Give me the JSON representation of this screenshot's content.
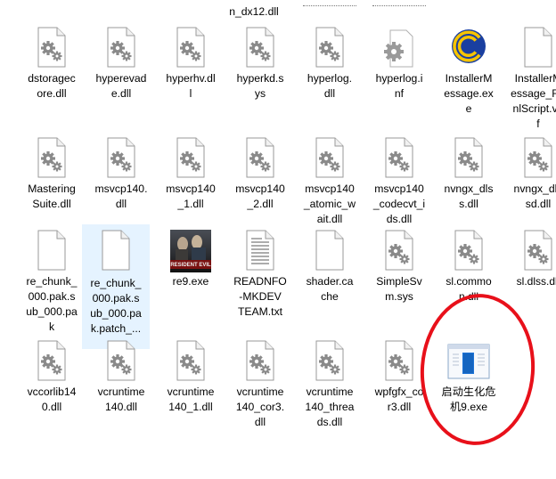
{
  "top_fragments": [
    "n_dx12.dll",
    "",
    ""
  ],
  "rows": [
    [
      {
        "name": "dstoragecore.dll",
        "label": "dstoragec\nore.dll",
        "icon": "dll-gear-icon"
      },
      {
        "name": "hyperevade.dll",
        "label": "hyperevad\ne.dll",
        "icon": "dll-gear-icon"
      },
      {
        "name": "hyperhv.dll",
        "label": "hyperhv.dl\nl",
        "icon": "dll-gear-icon"
      },
      {
        "name": "hyperkd.sys",
        "label": "hyperkd.s\nys",
        "icon": "dll-gear-icon"
      },
      {
        "name": "hyperlog.dll",
        "label": "hyperlog.\ndll",
        "icon": "dll-gear-icon"
      },
      {
        "name": "hyperlog.inf",
        "label": "hyperlog.i\nnf",
        "icon": "inf-gear-icon"
      },
      {
        "name": "InstallerMessage.exe",
        "label": "InstallerM\nessage.ex\ne",
        "icon": "capcom-logo-icon"
      },
      {
        "name": "InstallerMessage_RunScript.vdf",
        "label": "InstallerM\nessage_Ru\nnlScript.vd\nf",
        "icon": "blank-file-icon"
      }
    ],
    [
      {
        "name": "MasteringSuite.dll",
        "label": "Mastering\nSuite.dll",
        "icon": "dll-gear-icon"
      },
      {
        "name": "msvcp140.dll",
        "label": "msvcp140.\ndll",
        "icon": "dll-gear-icon"
      },
      {
        "name": "msvcp140_1.dll",
        "label": "msvcp140\n_1.dll",
        "icon": "dll-gear-icon"
      },
      {
        "name": "msvcp140_2.dll",
        "label": "msvcp140\n_2.dll",
        "icon": "dll-gear-icon"
      },
      {
        "name": "msvcp140_atomic_wait.dll",
        "label": "msvcp140\n_atomic_w\nait.dll",
        "icon": "dll-gear-icon"
      },
      {
        "name": "msvcp140_codecvt_ids.dll",
        "label": "msvcp140\n_codecvt_i\nds.dll",
        "icon": "dll-gear-icon"
      },
      {
        "name": "nvngx_dlss.dll",
        "label": "nvngx_dls\ns.dll",
        "icon": "dll-gear-icon"
      },
      {
        "name": "nvngx_dlssd.dll",
        "label": "nvngx_dls\nsd.dll",
        "icon": "dll-gear-icon"
      }
    ],
    [
      {
        "name": "re_chunk_000.pak.sub_000.pak",
        "label": "re_chunk_\n000.pak.s\nub_000.pa\nk",
        "icon": "blank-file-icon"
      },
      {
        "name": "re_chunk_000.pak.sub_000.pak.patch",
        "label": "re_chunk_\n000.pak.s\nub_000.pa\nk.patch_...",
        "icon": "blank-file-icon",
        "selected": true
      },
      {
        "name": "re9.exe",
        "label": "re9.exe",
        "icon": "resident-evil-game-icon"
      },
      {
        "name": "READNFO-MKDEVTEAM.txt",
        "label": "READNFO\n-MKDEV\nTEAM.txt",
        "icon": "text-file-icon"
      },
      {
        "name": "shader.cache",
        "label": "shader.ca\nche",
        "icon": "blank-file-icon"
      },
      {
        "name": "SimpleSvm.sys",
        "label": "SimpleSv\nm.sys",
        "icon": "dll-gear-icon"
      },
      {
        "name": "sl.common.dll",
        "label": "sl.commo\nn.dll",
        "icon": "dll-gear-icon"
      },
      {
        "name": "sl.dlss.dll",
        "label": "sl.dlss.dll",
        "icon": "dll-gear-icon"
      }
    ],
    [
      {
        "name": "vccorlib140.dll",
        "label": "vccorlib14\n0.dll",
        "icon": "dll-gear-icon"
      },
      {
        "name": "vcruntime140.dll",
        "label": "vcruntime\n140.dll",
        "icon": "dll-gear-icon"
      },
      {
        "name": "vcruntime140_1.dll",
        "label": "vcruntime\n140_1.dll",
        "icon": "dll-gear-icon"
      },
      {
        "name": "vcruntime140_cor3.dll",
        "label": "vcruntime\n140_cor3.\ndll",
        "icon": "dll-gear-icon"
      },
      {
        "name": "vcruntime140_threads.dll",
        "label": "vcruntime\n140_threa\nds.dll",
        "icon": "dll-gear-icon"
      },
      {
        "name": "wpfgfx_cor3.dll",
        "label": "wpfgfx_co\nr3.dll",
        "icon": "dll-gear-icon"
      },
      {
        "name": "启动生化危机9.exe",
        "label": "启动生化危\n机9.exe",
        "icon": "exe-window-icon"
      }
    ]
  ],
  "annotation": {
    "color": "#e8101a",
    "shape": "red-circle-highlight"
  }
}
